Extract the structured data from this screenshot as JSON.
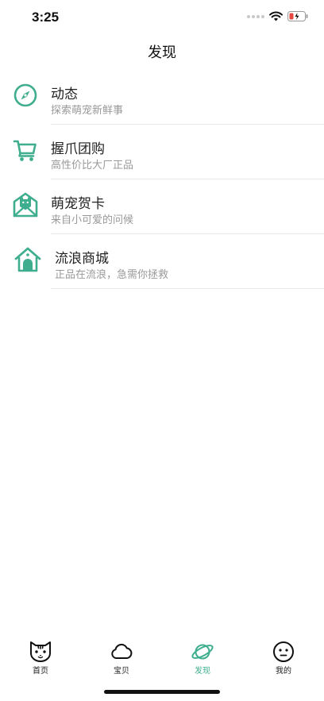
{
  "status_bar": {
    "time": "3:25"
  },
  "header": {
    "title": "发现"
  },
  "colors": {
    "accent": "#3fae8e",
    "subtitle": "#999999",
    "divider": "#e8e8e8"
  },
  "menu": [
    {
      "title": "动态",
      "subtitle": "探索萌宠新鲜事",
      "icon": "compass-icon"
    },
    {
      "title": "握爪团购",
      "subtitle": "高性价比大厂正品",
      "icon": "cart-icon"
    },
    {
      "title": "萌宠贺卡",
      "subtitle": "来自小可爱的问候",
      "icon": "mail-card-icon"
    },
    {
      "title": "流浪商城",
      "subtitle": "正品在流浪，急需你拯救",
      "icon": "pet-house-icon"
    }
  ],
  "tabs": [
    {
      "label": "首页",
      "icon": "cat-face-icon",
      "active": false
    },
    {
      "label": "宝贝",
      "icon": "cloud-icon",
      "active": false
    },
    {
      "label": "发现",
      "icon": "planet-icon",
      "active": true
    },
    {
      "label": "我的",
      "icon": "smiley-icon",
      "active": false
    }
  ]
}
